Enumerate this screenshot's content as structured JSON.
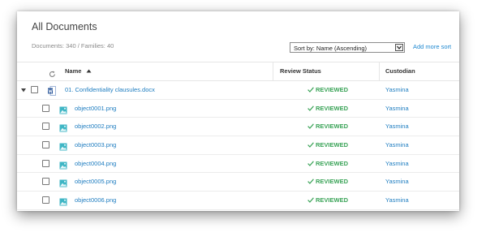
{
  "header": {
    "title": "All Documents",
    "meta": "Documents: 340 / Families: 40",
    "sort_label": "Sort by: Name (Ascending)",
    "add_sort": "Add more sort"
  },
  "table": {
    "columns": {
      "name": "Name",
      "status": "Review Status",
      "custodian": "Custodian"
    },
    "parent": {
      "name": "01. Confidentiality clausules.docx",
      "status": "REVIEWED",
      "custodian": "Yasmina"
    },
    "children": [
      {
        "name": "object0001.png",
        "status": "REVIEWED",
        "custodian": "Yasmina"
      },
      {
        "name": "object0002.png",
        "status": "REVIEWED",
        "custodian": "Yasmina"
      },
      {
        "name": "object0003.png",
        "status": "REVIEWED",
        "custodian": "Yasmina"
      },
      {
        "name": "object0004.png",
        "status": "REVIEWED",
        "custodian": "Yasmina"
      },
      {
        "name": "object0005.png",
        "status": "REVIEWED",
        "custodian": "Yasmina"
      },
      {
        "name": "object0006.png",
        "status": "REVIEWED",
        "custodian": "Yasmina"
      }
    ]
  },
  "colors": {
    "link": "#1e7dc0",
    "reviewed": "#3aa357",
    "word_icon": "#2b579a",
    "image_icon": "#3fb6c5"
  },
  "icons": [
    "refresh-icon",
    "sort-ascending-icon",
    "chevron-down-icon",
    "expand-caret-icon",
    "word-document-icon",
    "image-file-icon",
    "checkmark-icon"
  ]
}
